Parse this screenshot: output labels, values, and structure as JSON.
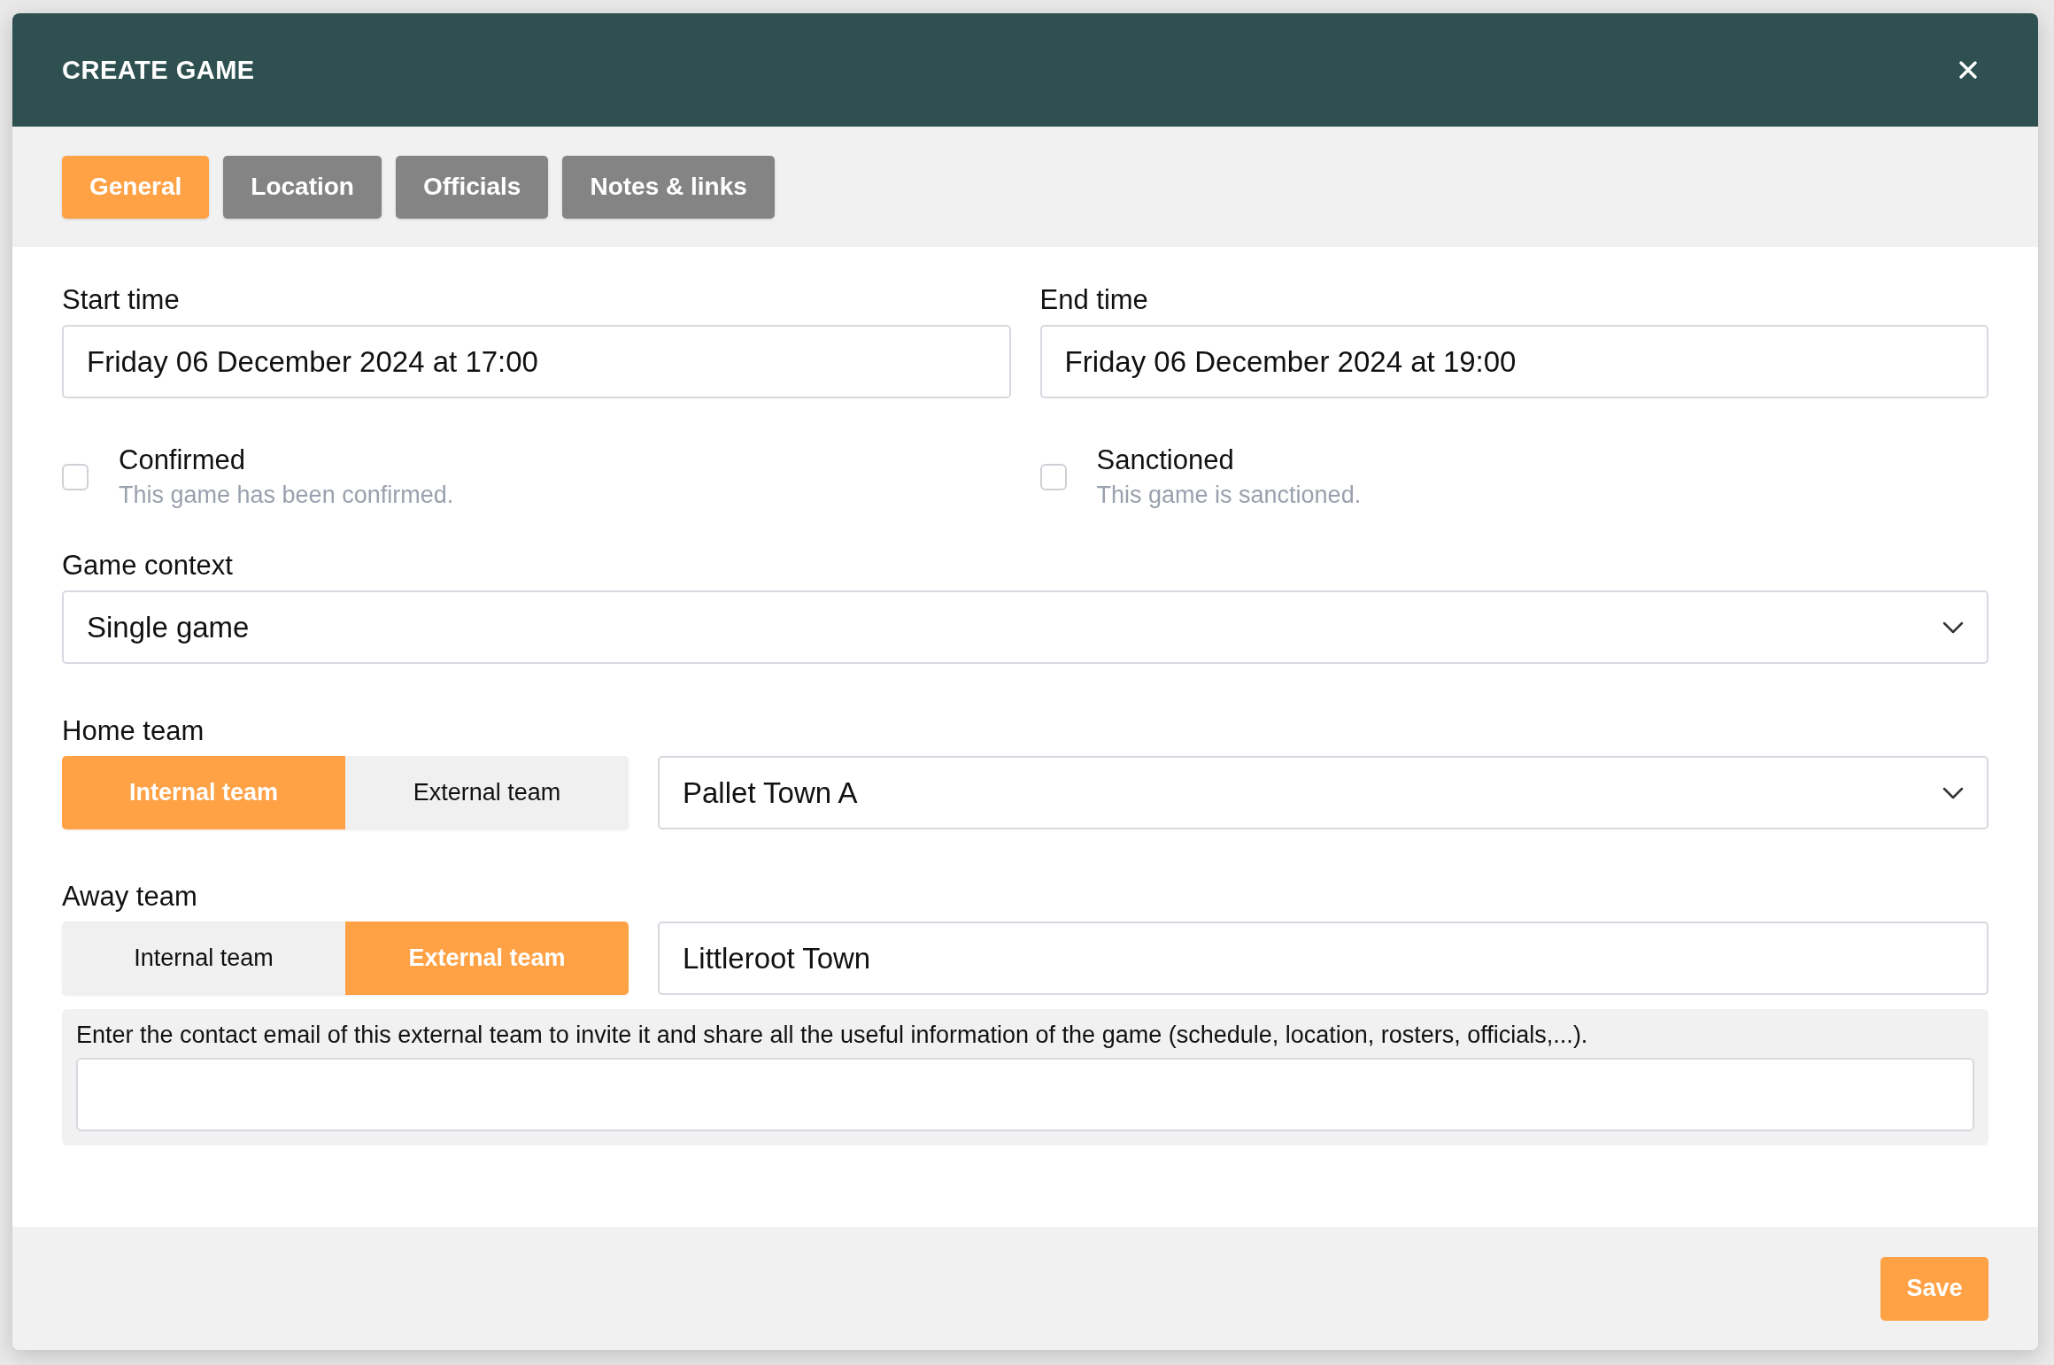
{
  "dialog": {
    "title": "CREATE GAME"
  },
  "tabs": [
    {
      "label": "General",
      "selected": true
    },
    {
      "label": "Location",
      "selected": false
    },
    {
      "label": "Officials",
      "selected": false
    },
    {
      "label": "Notes & links",
      "selected": false
    }
  ],
  "times": [
    {
      "label": "Start time",
      "value": "Friday 06 December 2024 at 17:00"
    },
    {
      "label": "End time",
      "value": "Friday 06 December 2024 at 19:00"
    }
  ],
  "checkboxes": [
    {
      "label": "Confirmed",
      "description": "This game has been confirmed.",
      "checked": false
    },
    {
      "label": "Sanctioned",
      "description": "This game is sanctioned.",
      "checked": false
    }
  ],
  "game_context": {
    "label": "Game context",
    "value": "Single game"
  },
  "teams": [
    {
      "label": "Home team",
      "options": [
        {
          "label": "Internal team",
          "selected": true
        },
        {
          "label": "External team",
          "selected": false
        }
      ],
      "kind": "select",
      "value": "Pallet Town A"
    },
    {
      "label": "Away team",
      "options": [
        {
          "label": "Internal team",
          "selected": false
        },
        {
          "label": "External team",
          "selected": true
        }
      ],
      "kind": "input",
      "value": "Littleroot Town"
    }
  ],
  "invite": {
    "prompt": "Enter the contact email of this external team to invite it and share all the useful information of the game (schedule, location, rosters, officials,...)."
  },
  "footer": {
    "save_button": "Save"
  }
}
